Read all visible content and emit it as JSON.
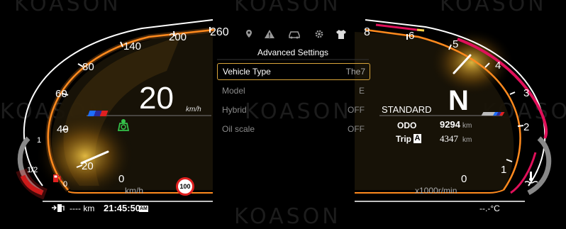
{
  "watermark": "KOASON",
  "speedometer": {
    "ticks": [
      "0",
      "20",
      "40",
      "60",
      "80",
      "140",
      "200",
      "260"
    ],
    "speed": "20",
    "speed_unit": "km/h",
    "bottom_unit": "km/h",
    "speed_limit": "100",
    "speed_value": 20
  },
  "fuel_gauge": {
    "full": "1",
    "half": "1/2",
    "empty": "0"
  },
  "tachometer": {
    "ticks": [
      "0",
      "1",
      "2",
      "3",
      "4",
      "5",
      "6",
      "8"
    ],
    "unit": "x1000r/min",
    "rpm_value": 5.1
  },
  "menu": {
    "title": "Advanced Settings",
    "icons": [
      "location-icon",
      "warning-icon",
      "car-icon",
      "gear-icon",
      "shirt-icon"
    ],
    "items": [
      {
        "label": "Vehicle Type",
        "value": "The7",
        "selected": true
      },
      {
        "label": "Model",
        "value": "E",
        "selected": false
      },
      {
        "label": "Hybrid",
        "value": "OFF",
        "selected": false
      },
      {
        "label": "Oil scale",
        "value": "OFF",
        "selected": false
      }
    ]
  },
  "drive": {
    "mode": "STANDARD",
    "gear": "N",
    "odo_label": "ODO",
    "odo_value": "9294",
    "odo_unit": "km",
    "trip_label": "Trip",
    "trip_id": "A",
    "trip_value": "4347",
    "trip_unit": "km"
  },
  "status_bar": {
    "range": "---- km",
    "time": "21:45:50",
    "ampm": "AM",
    "temperature": "--.-°C"
  },
  "colors": {
    "accent_orange": "#ff8a1e",
    "redline": "#e0105a",
    "needle_glow": "#ffd24a",
    "selection_border": "#d9a53a",
    "eco_green": "#35c24a"
  }
}
